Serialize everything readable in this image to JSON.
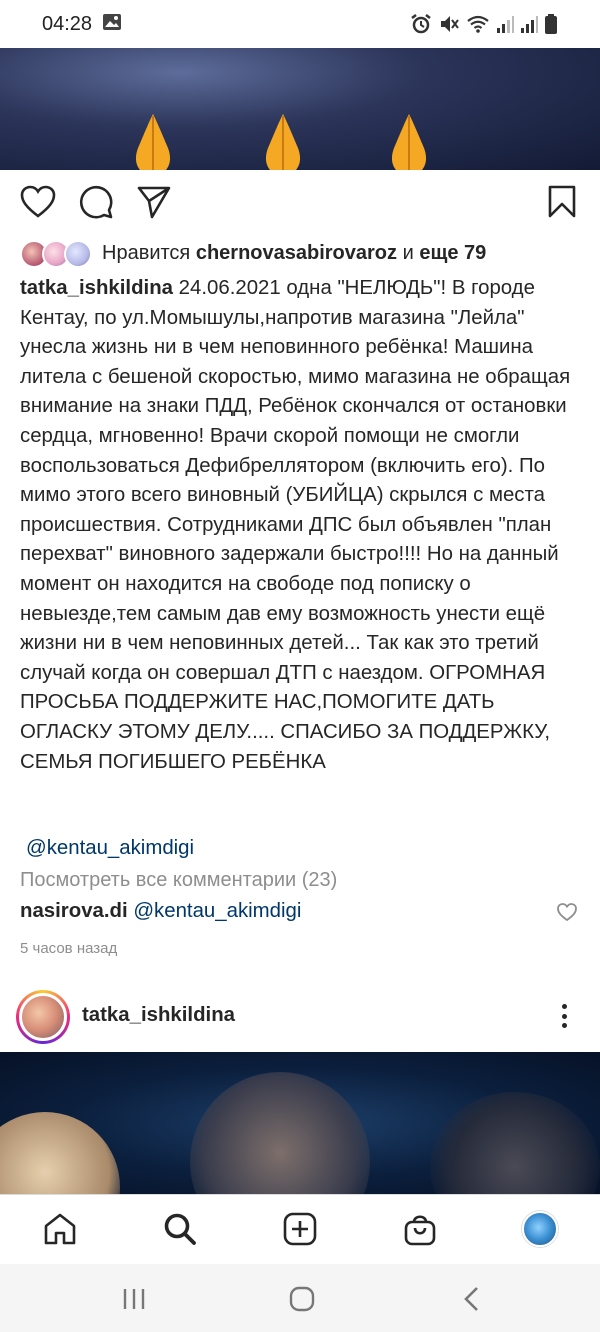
{
  "status_bar": {
    "time": "04:28",
    "icons": [
      "gallery-icon",
      "alarm-icon",
      "mute-icon",
      "wifi-icon",
      "signal-icon",
      "signal-icon",
      "battery-icon"
    ]
  },
  "post": {
    "likes": {
      "prefix": "Нравится",
      "user": "chernovasabirovaroz",
      "and": "и",
      "others": "еще 79"
    },
    "caption": {
      "username": "tatka_ishkildina",
      "text": "24.06.2021 одна \"НЕЛЮДЬ\"! В городе Кентау, по ул.Момышулы,напротив магазина \"Лейла\" унесла жизнь ни в чем неповинного ребёнка! Машина литела с бешеной скоростью, мимо магазина не обращая внимание на знаки ПДД, Ребёнок скончался от остановки сердца, мгновенно! Врачи скорой помощи не смогли воспользоваться Дефибреллятором (включить его). По мимо этого всего виновный (УБИЙЦА) скрылся с места происшествия. Сотрудниками ДПС был объявлен \"план перехват\" виновного задержали быстро!!!! Но на данный момент он находится на свободе под пописку о невыезде,тем самым дав ему возможность унести ещё жизни ни в чем неповинных детей... Так как это третий случай когда он совершал ДТП с наездом. ОГРОМНАЯ ПРОСЬБА ПОДДЕРЖИТЕ НАС,ПОМОГИТЕ ДАТЬ ОГЛАСКУ ЭТОМУ ДЕЛУ..... СПАСИБО ЗА ПОДДЕРЖКУ, СЕМЬЯ ПОГИБШЕГО РЕБЁНКА",
      "mention": "@kentau_akimdigi"
    },
    "view_all_comments": "Посмотреть все комментарии (23)",
    "top_comment": {
      "username": "nasirova.di",
      "text": "@kentau_akimdigi"
    },
    "time_ago": "5 часов назад"
  },
  "next_post": {
    "username": "tatka_ishkildina"
  },
  "bottom_nav": [
    "home-icon",
    "search-icon",
    "add-post-icon",
    "shop-icon",
    "profile-avatar"
  ],
  "colors": {
    "mention": "#00376b",
    "muted": "#8e8e8e",
    "text": "#262626"
  }
}
